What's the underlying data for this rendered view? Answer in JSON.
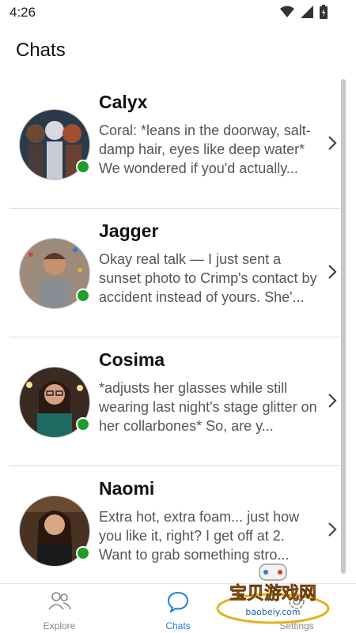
{
  "status_bar": {
    "time": "4:26"
  },
  "header": {
    "title": "Chats"
  },
  "chats": [
    {
      "name": "Calyx",
      "preview": "Coral: *leans in the doorway, salt-damp hair, eyes like deep water* We wondered if you'd actually...",
      "online": true
    },
    {
      "name": "Jagger",
      "preview": "Okay real talk — I just sent a sunset photo to Crimp's contact by accident instead of yours. She'...",
      "online": true
    },
    {
      "name": "Cosima",
      "preview": "*adjusts her glasses while still wearing last night's stage glitter on her collarbones* So, are y...",
      "online": true
    },
    {
      "name": "Naomi",
      "preview": "Extra hot, extra foam... just how you like it, right? I get off at 2. Want to grab something stro...",
      "online": true
    }
  ],
  "bottom_nav": {
    "items": [
      {
        "label": "Explore",
        "icon": "people-icon",
        "active": false
      },
      {
        "label": "Chats",
        "icon": "chat-bubble-icon",
        "active": true
      },
      {
        "label": "Settings",
        "icon": "gear-icon",
        "active": false
      }
    ]
  },
  "watermark": {
    "text_cn": "宝贝游戏网",
    "text_url": "baobeiy.com"
  },
  "colors": {
    "accent": "#1f7fd8",
    "online": "#1f9d2a",
    "divider": "#dcdcdc"
  }
}
